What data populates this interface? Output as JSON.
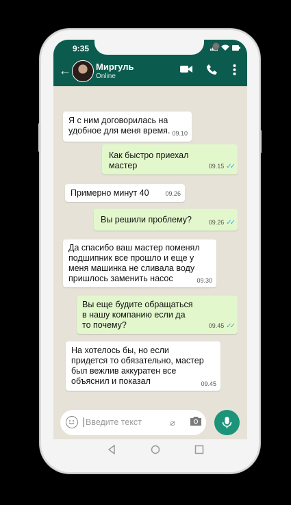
{
  "status_bar": {
    "time": "9:35"
  },
  "contact": {
    "name": "Миргуль",
    "status": "Online"
  },
  "messages": [
    {
      "dir": "in",
      "text": "Я с ним договорилась на\nудобное для меня время.",
      "time": "09.10"
    },
    {
      "dir": "out",
      "text": "Как быстро приехал\nмастер",
      "time": "09.15"
    },
    {
      "dir": "in",
      "text": "Примерно минут 40",
      "time": "09.26"
    },
    {
      "dir": "out",
      "text": "Вы решили проблему?",
      "time": "09.26"
    },
    {
      "dir": "in",
      "text": "Да спасибо ваш мастер поменял\nподшипник все прошло и еще у\nменя машинка не сливала воду\nпришлось заменить насос",
      "time": "09.30"
    },
    {
      "dir": "out",
      "text": "Вы еще будите обращаться\nв нашу компанию если да\nто почему?",
      "time": "09.45"
    },
    {
      "dir": "in",
      "text": "На хотелось бы, но если\nпридется то обязательно, мастер\nбыл вежлив аккуратен все\nобъяснил и показал",
      "time": "09.45"
    }
  ],
  "composer": {
    "placeholder": "Введите текст"
  },
  "colors": {
    "header": "#0b5c4e",
    "chat_bg": "#e6e2d7",
    "outgoing": "#e2f7cc",
    "mic": "#1b9479",
    "ticks": "#4fa3e0"
  },
  "icons": [
    "back-arrow-icon",
    "video-call-icon",
    "phone-icon",
    "more-icon",
    "emoji-icon",
    "attach-icon",
    "camera-icon",
    "mic-icon",
    "nav-back-icon",
    "nav-home-icon",
    "nav-recents-icon"
  ]
}
